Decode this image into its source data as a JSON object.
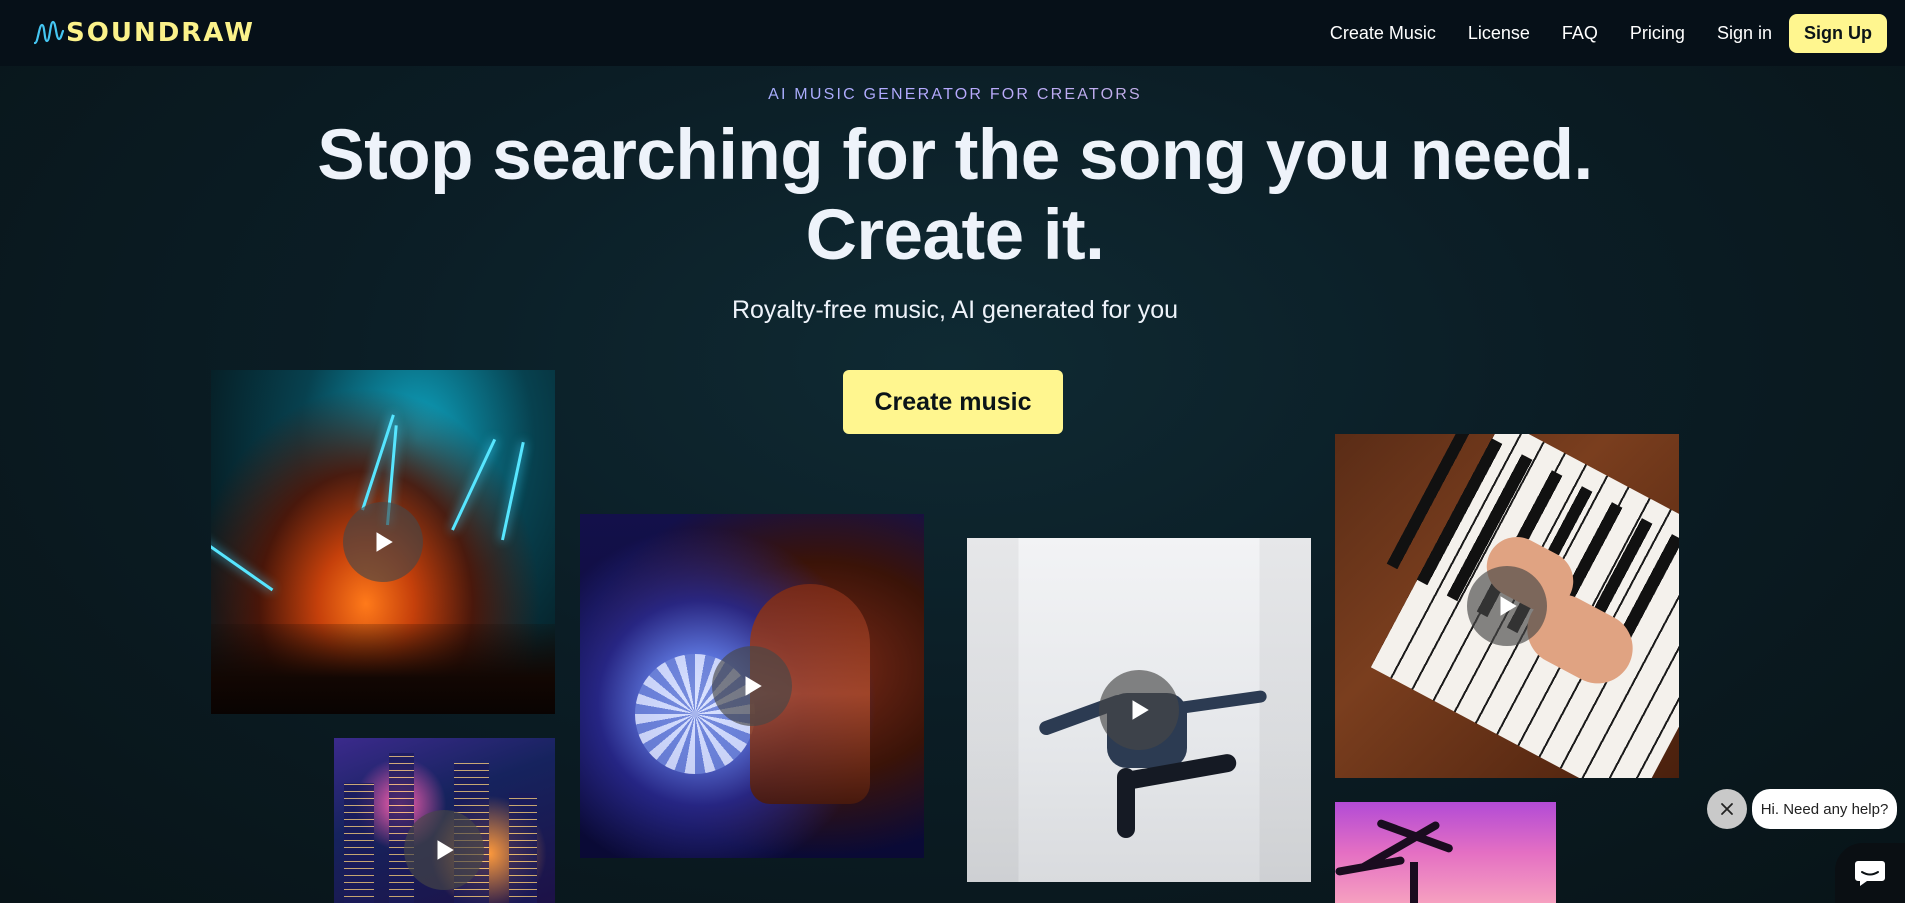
{
  "brand": {
    "name": "SOUNDRAW",
    "logo_icon": "waveform-icon",
    "color": "#fbf28a"
  },
  "nav": {
    "links": [
      "Create Music",
      "License",
      "FAQ",
      "Pricing",
      "Sign in"
    ],
    "signup_label": "Sign Up"
  },
  "hero": {
    "eyebrow": "AI MUSIC GENERATOR FOR CREATORS",
    "headline_line1": "Stop searching for the song you need.",
    "headline_line2": "Create it.",
    "subhead": "Royalty-free music, AI generated for you",
    "cta_label": "Create music"
  },
  "tiles": [
    {
      "name": "concert-tile",
      "icon": "play-icon"
    },
    {
      "name": "city-tile",
      "icon": "play-icon"
    },
    {
      "name": "disco-tile",
      "icon": "play-icon"
    },
    {
      "name": "dancer-tile",
      "icon": "play-icon"
    },
    {
      "name": "piano-tile",
      "icon": "play-icon"
    },
    {
      "name": "palm-tile",
      "icon": "play-icon"
    }
  ],
  "chat": {
    "greeting": "Hi. Need any help?",
    "close_icon": "close-icon",
    "launcher_icon": "chat-icon"
  },
  "colors": {
    "accent": "#fff68f",
    "nav_bg": "#061018",
    "page_bg": "#0b1d25"
  }
}
